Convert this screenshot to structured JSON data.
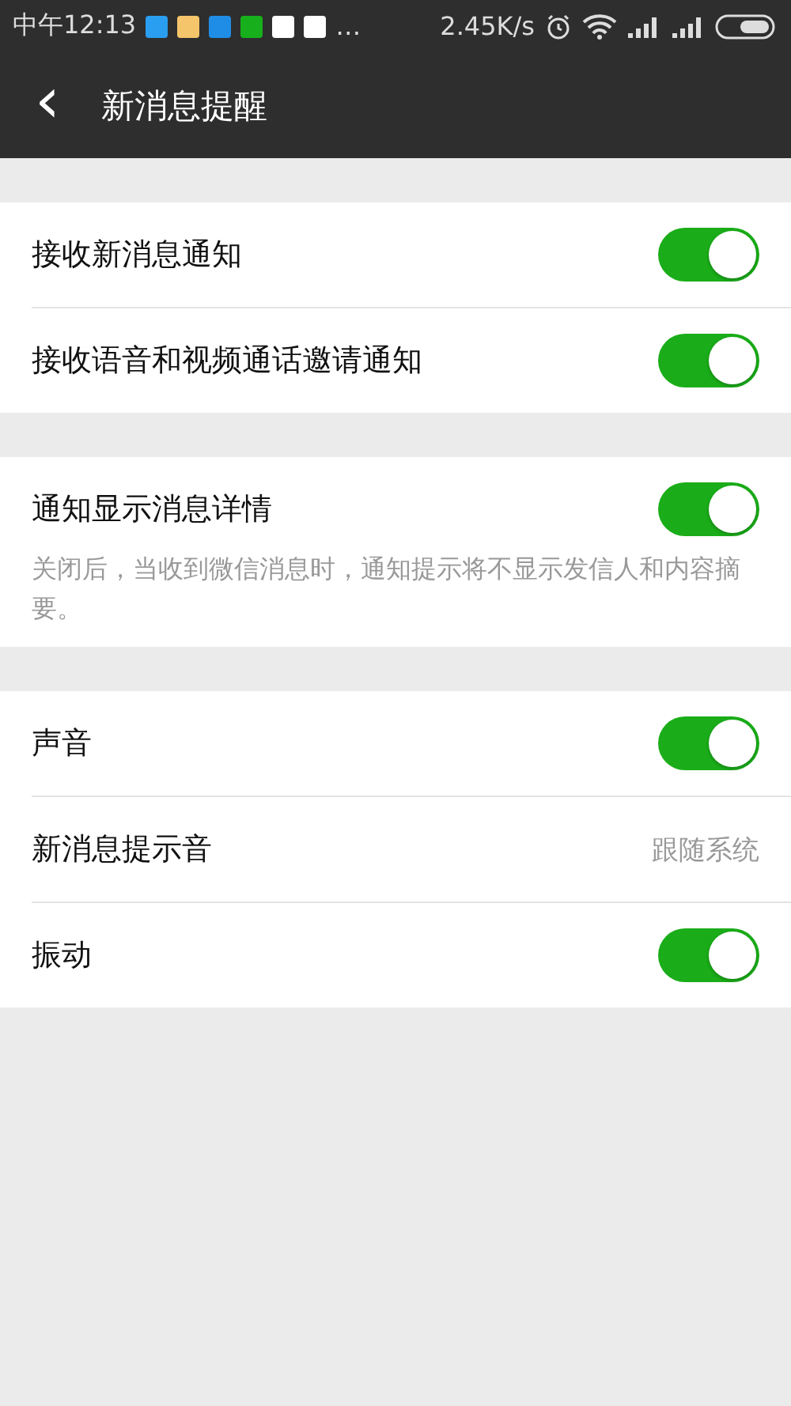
{
  "status_bar": {
    "time": "中午12:13",
    "more": "…",
    "speed": "2.45K/s"
  },
  "header": {
    "back": "‹",
    "title": "新消息提醒"
  },
  "groups": [
    {
      "items": [
        {
          "kind": "toggle",
          "label": "接收新消息通知",
          "on": true
        },
        {
          "kind": "toggle",
          "label": "接收语音和视频通话邀请通知",
          "on": true
        }
      ]
    },
    {
      "items": [
        {
          "kind": "toggle",
          "label": "通知显示消息详情",
          "on": true
        }
      ],
      "note": "关闭后，当收到微信消息时，通知提示将不显示发信人和内容摘要。"
    },
    {
      "items": [
        {
          "kind": "toggle",
          "label": "声音",
          "on": true
        },
        {
          "kind": "value",
          "label": "新消息提示音",
          "value": "跟随系统"
        },
        {
          "kind": "toggle",
          "label": "振动",
          "on": true
        }
      ]
    }
  ]
}
